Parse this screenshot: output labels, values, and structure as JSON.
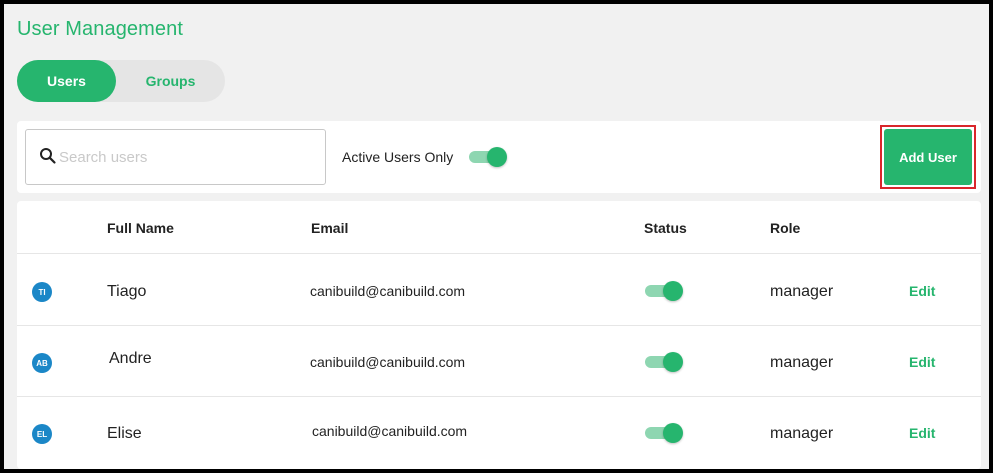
{
  "page": {
    "title": "User Management"
  },
  "tabs": [
    {
      "label": "Users",
      "active": true
    },
    {
      "label": "Groups",
      "active": false
    }
  ],
  "toolbar": {
    "search_placeholder": "Search users",
    "search_value": "",
    "active_only_label": "Active Users Only",
    "active_only_on": true,
    "add_user_label": "Add User"
  },
  "table": {
    "headers": {
      "full_name": "Full Name",
      "email": "Email",
      "status": "Status",
      "role": "Role"
    },
    "rows": [
      {
        "initials": "TI",
        "name": "Tiago",
        "email": "canibuild@canibuild.com",
        "active": true,
        "role": "manager",
        "edit_label": "Edit"
      },
      {
        "initials": "AB",
        "name": "Andre",
        "email": "canibuild@canibuild.com",
        "active": true,
        "role": "manager",
        "edit_label": "Edit"
      },
      {
        "initials": "EL",
        "name": "Elise",
        "email": "canibuild@canibuild.com",
        "active": true,
        "role": "manager",
        "edit_label": "Edit"
      }
    ]
  },
  "colors": {
    "accent": "#26b56e",
    "avatar": "#1b87c7",
    "highlight_border": "#d9262b"
  }
}
